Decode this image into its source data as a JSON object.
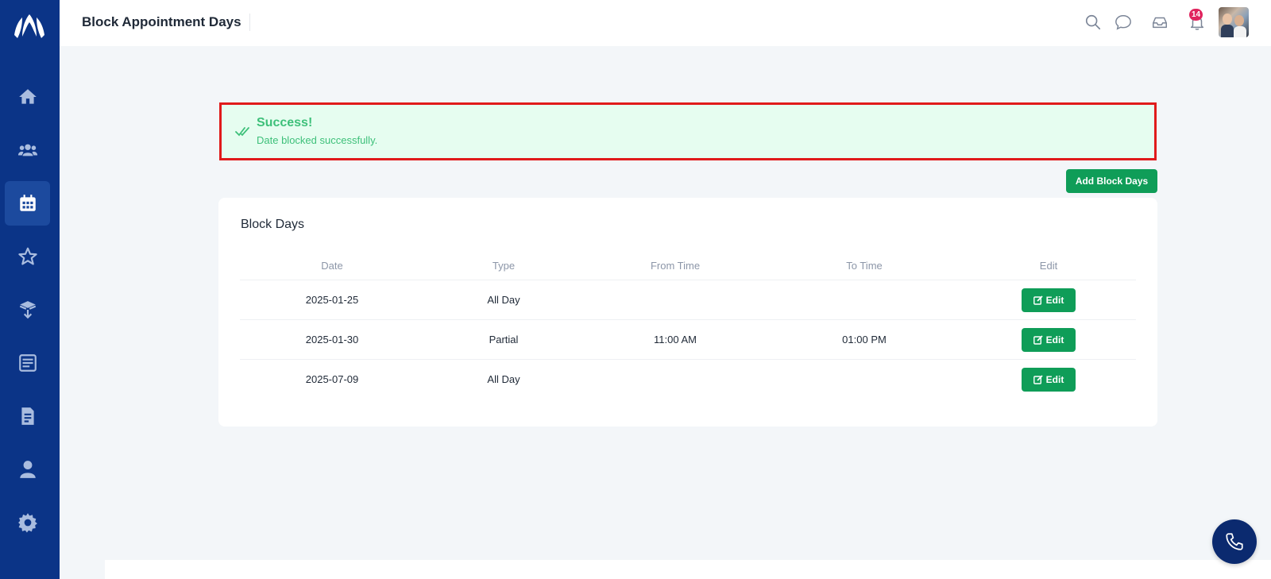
{
  "header": {
    "title": "Block Appointment Days",
    "notification_count": "14"
  },
  "sidebar": {
    "items": [
      {
        "icon": "home-icon"
      },
      {
        "icon": "users-icon"
      },
      {
        "icon": "calendar-icon",
        "active": true
      },
      {
        "icon": "star-icon"
      },
      {
        "icon": "box-icon"
      },
      {
        "icon": "report-icon"
      },
      {
        "icon": "document-icon"
      },
      {
        "icon": "user-icon"
      },
      {
        "icon": "gear-icon"
      }
    ]
  },
  "alert": {
    "title": "Success!",
    "message": "Date blocked successfully."
  },
  "actions": {
    "add_label": "Add Block Days"
  },
  "card": {
    "title": "Block Days",
    "columns": [
      "Date",
      "Type",
      "From Time",
      "To Time",
      "Edit"
    ],
    "rows": [
      {
        "date": "2025-01-25",
        "type": "All Day",
        "from": "",
        "to": "",
        "edit": "Edit"
      },
      {
        "date": "2025-01-30",
        "type": "Partial",
        "from": "11:00 AM",
        "to": "01:00 PM",
        "edit": "Edit"
      },
      {
        "date": "2025-07-09",
        "type": "All Day",
        "from": "",
        "to": "",
        "edit": "Edit"
      }
    ]
  },
  "colors": {
    "sidebar": "#0b3487",
    "primary_green": "#0f9d58",
    "alert_border": "#e01b1b",
    "alert_bg": "#e6fdf0"
  }
}
